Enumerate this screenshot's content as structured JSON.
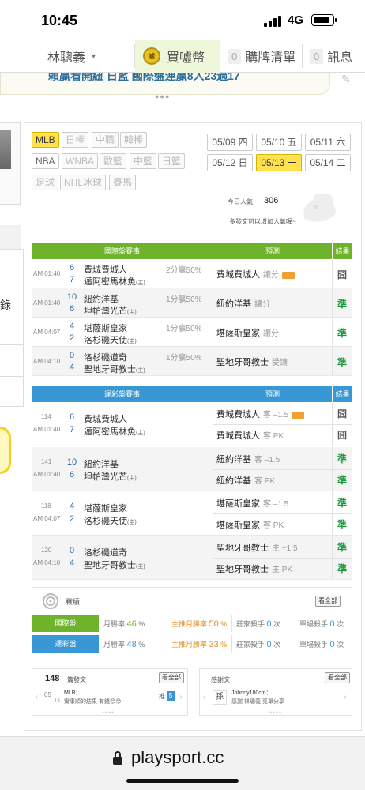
{
  "status_bar": {
    "time": "10:45",
    "network": "4G"
  },
  "nav": {
    "user_name": "林聰義",
    "buy_coins_label": "買噓幣",
    "coin_badge": "噓",
    "cart_count": "0",
    "cart_label": "購牌清單",
    "msg_count": "0",
    "msg_label": "訊息"
  },
  "banner": {
    "text": "賴贏看開紐 日藍 國際盤連贏8人23過17"
  },
  "sport_tags": [
    "MLB",
    "日棒",
    "中職",
    "韓棒",
    "NBA",
    "WNBA",
    "歐籃",
    "中籃",
    "日籃",
    "足球",
    "NHL冰球",
    "賽馬"
  ],
  "dates": [
    "05/09 四",
    "05/10 五",
    "05/11 六",
    "05/12 日",
    "05/13 一",
    "05/14 二"
  ],
  "popularity": {
    "label": "今日人氣",
    "value": "306",
    "hint": "多發文可以增加人氣喔~"
  },
  "intl_table": {
    "headers": {
      "games": "國際盤賽事",
      "prediction": "預測",
      "result": "結果"
    },
    "rows": [
      {
        "time": "AM 01:40",
        "n1": "6",
        "t1": "費城費城人",
        "n2": "7",
        "t2": "邁阿密馬林魚",
        "odds": "2分贏50%",
        "pick": "費城費城人",
        "pick_note": "讓分",
        "result": "囧"
      },
      {
        "time": "AM 01:40",
        "n1": "10",
        "t1": "紐約洋基",
        "n2": "6",
        "t2": "坦帕灣光芒",
        "odds": "1分贏50%",
        "pick": "紐約洋基",
        "pick_note": "讓分",
        "result": "準"
      },
      {
        "time": "AM 04:07",
        "n1": "4",
        "t1": "堪薩斯皇家",
        "n2": "2",
        "t2": "洛杉磯天使",
        "odds": "1分贏50%",
        "pick": "堪薩斯皇家",
        "pick_note": "讓分",
        "result": "準"
      },
      {
        "time": "AM 04:10",
        "n1": "0",
        "t1": "洛杉磯道奇",
        "n2": "4",
        "t2": "聖地牙哥教士",
        "odds": "1分贏50%",
        "pick": "聖地牙哥教士",
        "pick_note": "受讓",
        "result": "準"
      }
    ]
  },
  "lottery_table": {
    "headers": {
      "games": "運彩盤賽事",
      "prediction": "預測",
      "result": "結果"
    },
    "rows": [
      {
        "num": "114",
        "time": "AM 01:40",
        "n1": "6",
        "t1": "費城費城人",
        "n2": "7",
        "t2": "邁阿密馬林魚",
        "p1": "費城費城人",
        "p1_note": "客 –1.5",
        "r1": "囧",
        "p2": "費城費城人",
        "p2_note": "客 PK",
        "r2": "囧"
      },
      {
        "num": "141",
        "time": "AM 01:40",
        "n1": "10",
        "t1": "紐約洋基",
        "n2": "6",
        "t2": "坦帕灣光芒",
        "p1": "紐約洋基",
        "p1_note": "客 –1.5",
        "r1": "準",
        "p2": "紐約洋基",
        "p2_note": "客 PK",
        "r2": "準"
      },
      {
        "num": "118",
        "time": "AM 04:07",
        "n1": "4",
        "t1": "堪薩斯皇家",
        "n2": "2",
        "t2": "洛杉磯天使",
        "p1": "堪薩斯皇家",
        "p1_note": "客 –1.5",
        "r1": "準",
        "p2": "堪薩斯皇家",
        "p2_note": "客 PK",
        "r2": "準"
      },
      {
        "num": "120",
        "time": "AM 04:10",
        "n1": "0",
        "t1": "洛杉磯道奇",
        "n2": "4",
        "t2": "聖地牙哥教士",
        "p1": "聖地牙哥教士",
        "p1_note": "主 +1.5",
        "r1": "準",
        "p2": "聖地牙哥教士",
        "p2_note": "主 PK",
        "r2": "準"
      }
    ]
  },
  "stats": {
    "title": "戰績",
    "view_all": "看全部",
    "rows": [
      {
        "label": "國際盤",
        "win_label": "月勝率",
        "win": "46",
        "home_label": "主推月勝率",
        "home": "50",
        "killer_label": "莊家殺手",
        "killer": "0",
        "single_label": "單場殺手",
        "single": "0"
      },
      {
        "label": "運彩盤",
        "win_label": "月勝率",
        "win": "48",
        "home_label": "主推月勝率",
        "home": "33",
        "killer_label": "莊家殺手",
        "killer": "0",
        "single_label": "單場殺手",
        "single": "0"
      }
    ],
    "unit_pct": "%",
    "unit_times": "次"
  },
  "posts": {
    "count": "148",
    "label": "篇發文",
    "view_all": "看全部",
    "date_top": "05",
    "date_bottom": "13",
    "title": "MLB：",
    "excerpt": "實事順的結果 有錢😊😊",
    "push_label": "推",
    "push_count": "5"
  },
  "thanks": {
    "label": "感謝文",
    "view_all": "看全部",
    "user": "Johnny180cm：",
    "text": "感謝 林聰義 亮單分享",
    "avatar": "孫"
  },
  "browser": {
    "url": "playsport.cc"
  },
  "colors": {
    "green": "#6fb22c",
    "blue": "#3a97d6",
    "yellow": "#ffe24d",
    "win": "#1a9a3a"
  }
}
